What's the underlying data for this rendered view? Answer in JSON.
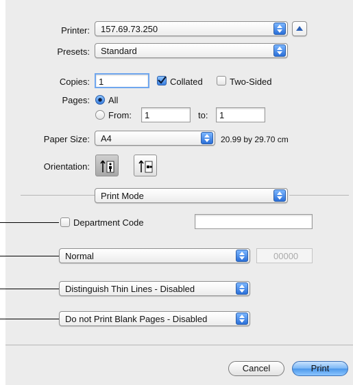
{
  "printer": {
    "label": "Printer:",
    "value": "157.69.73.250"
  },
  "presets": {
    "label": "Presets:",
    "value": "Standard"
  },
  "copies": {
    "label": "Copies:",
    "value": "1",
    "collated_label": "Collated",
    "collated_checked": true,
    "two_sided_label": "Two-Sided",
    "two_sided_checked": false
  },
  "pages": {
    "label": "Pages:",
    "all_label": "All",
    "from_label": "From:",
    "from_value": "1",
    "to_label": "to:",
    "to_value": "1",
    "selected": "All"
  },
  "paper_size": {
    "label": "Paper Size:",
    "value": "A4",
    "dimensions": "20.99 by 29.70 cm"
  },
  "orientation": {
    "label": "Orientation:",
    "selected": "portrait"
  },
  "section": {
    "value": "Print Mode"
  },
  "department_code": {
    "label": "Department Code",
    "checked": false,
    "value": ""
  },
  "mode": {
    "value": "Normal",
    "code_placeholder": "00000"
  },
  "thin_lines": {
    "value": "Distinguish Thin Lines - Disabled"
  },
  "blank_pages": {
    "value": "Do not Print Blank Pages - Disabled"
  },
  "buttons": {
    "cancel": "Cancel",
    "print": "Print"
  },
  "icons": {
    "expand": "disclosure-triangle-icon",
    "stepper": "updown-arrows-icon",
    "portrait": "portrait-orientation-icon",
    "landscape": "landscape-orientation-icon"
  },
  "colors": {
    "accent": "#3a7fe0",
    "dialog_bg": "#ececec"
  }
}
